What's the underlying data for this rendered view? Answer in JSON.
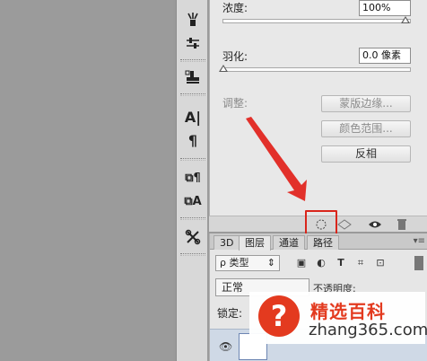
{
  "properties": {
    "density_label": "浓度:",
    "density_value": "100%",
    "feather_label": "羽化:",
    "feather_value": "0.0 像素",
    "adjust_label": "调整:",
    "mask_edge_button": "蒙版边缘...",
    "color_range_button": "颜色范围...",
    "invert_button": "反相"
  },
  "toolbar": {
    "icons": [
      "brush-presets-icon",
      "adjustments-icon",
      "stamp-icon",
      "character-icon",
      "paragraph-icon",
      "character-style-icon",
      "paragraph-style-icon",
      "tools-icon"
    ]
  },
  "layers": {
    "tabs": [
      "3D",
      "图层",
      "通道",
      "路径"
    ],
    "active_tab": "图层",
    "filter_kind": "类型",
    "blend_mode": "正常",
    "opacity_label": "不透明度:",
    "lock_label": "锁定:"
  },
  "watermark": {
    "symbol": "?",
    "title": "精选百科",
    "url": "zhang365.com"
  },
  "colors": {
    "highlight": "#d9261c",
    "arrow": "#e2302a",
    "brand": "#e33a1f"
  }
}
